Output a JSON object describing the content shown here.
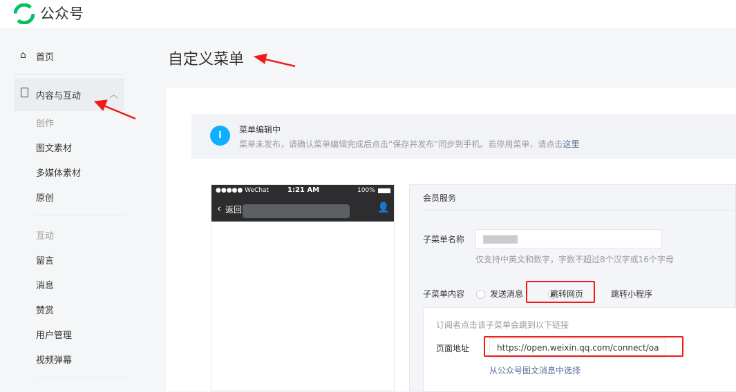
{
  "app": {
    "title": "公众号",
    "brand_color": "#07c160"
  },
  "sidebar": {
    "home": "首页",
    "content_group": "内容与互动",
    "sections": [
      {
        "header": "创作",
        "items": [
          "图文素材",
          "多媒体素材",
          "原创"
        ]
      },
      {
        "header": "互动",
        "items": [
          "留言",
          "消息",
          "赞赏",
          "用户管理",
          "视频弹幕"
        ]
      }
    ]
  },
  "page": {
    "title": "自定义菜单"
  },
  "notice": {
    "title": "菜单编辑中",
    "text": "菜单未发布，请确认菜单编辑完成后点击“保存并发布”同步到手机。若停用菜单，请点击",
    "link": "这里"
  },
  "phone": {
    "carrier": "●●●●● WeChat",
    "time": "1:21 AM",
    "battery": "100%",
    "back": "返回"
  },
  "editor": {
    "menu_name": "会员服务",
    "name_label": "子菜单名称",
    "name_hint": "仅支持中英文和数字，字数不超过8个汉字或16个字母",
    "content_label": "子菜单内容",
    "options": [
      "发送消息",
      "跳转网页",
      "跳转小程序"
    ],
    "selected": "跳转网页",
    "link_hint": "订阅者点击该子菜单会跳到以下链接",
    "url_label": "页面地址",
    "url_value": "https://open.weixin.qq.com/connect/oa",
    "choose_link": "从公众号图文消息中选择"
  },
  "colors": {
    "link": "#576b95",
    "annotation": "#f01a1a"
  }
}
